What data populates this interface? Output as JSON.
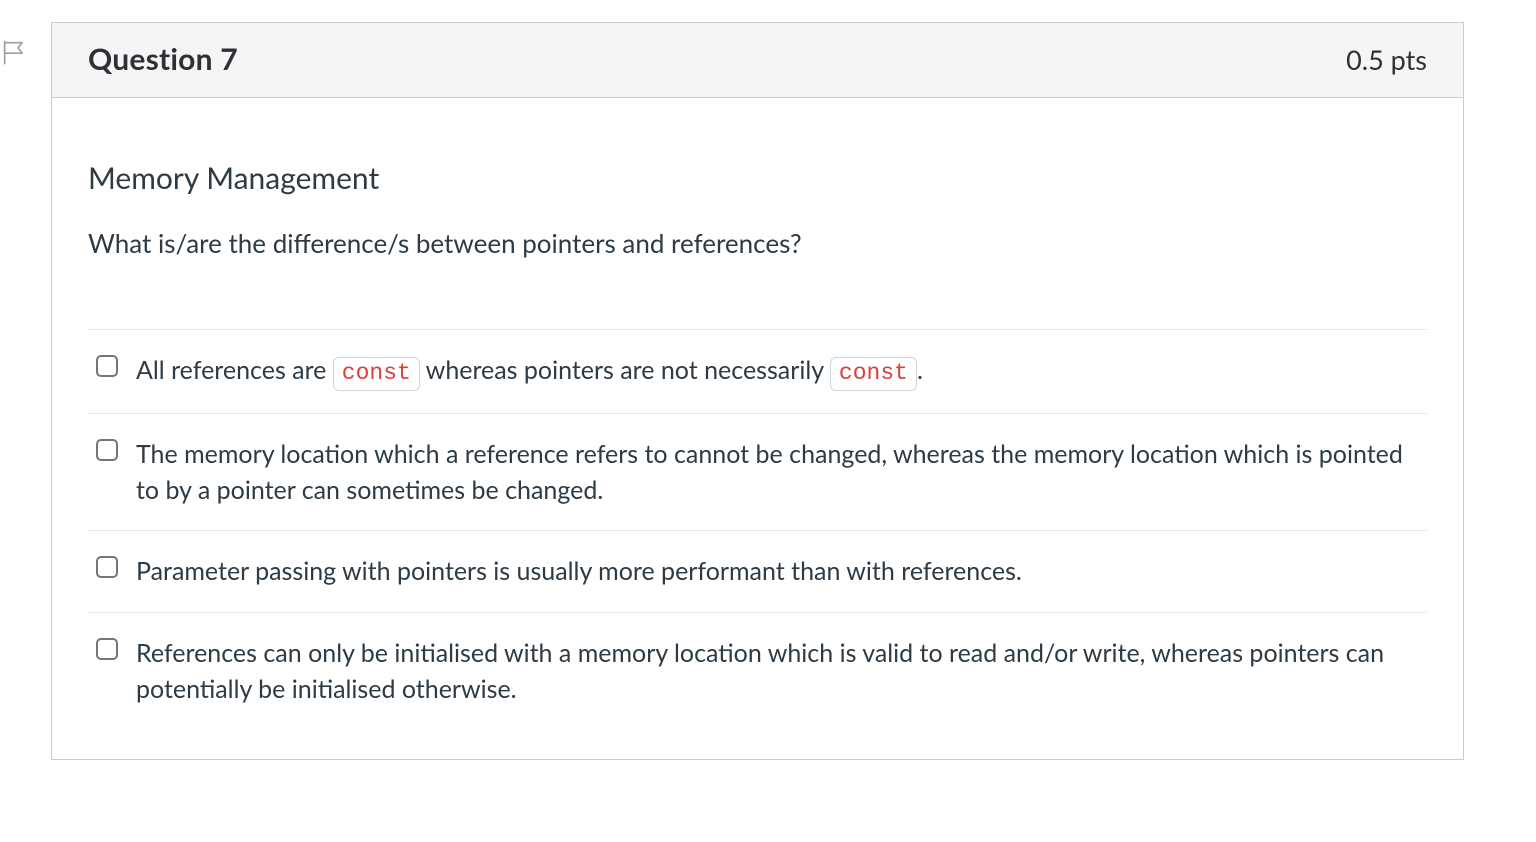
{
  "header": {
    "title": "Question 7",
    "points": "0.5 pts"
  },
  "body": {
    "topic": "Memory Management",
    "prompt": "What is/are the difference/s between pointers and references?"
  },
  "options": {
    "opt1": {
      "seg1": "All references are ",
      "kw1": "const",
      "seg2": " whereas pointers are not necessarily ",
      "kw2": "const",
      "seg3": "."
    },
    "opt2": "The memory location which a reference refers to cannot be changed, whereas the memory location which is pointed to by a pointer can sometimes be changed.",
    "opt3": "Parameter passing with pointers is usually more performant than with references.",
    "opt4": "References can only be initialised with a memory location which is valid to read and/or write, whereas pointers can potentially be initialised otherwise."
  }
}
